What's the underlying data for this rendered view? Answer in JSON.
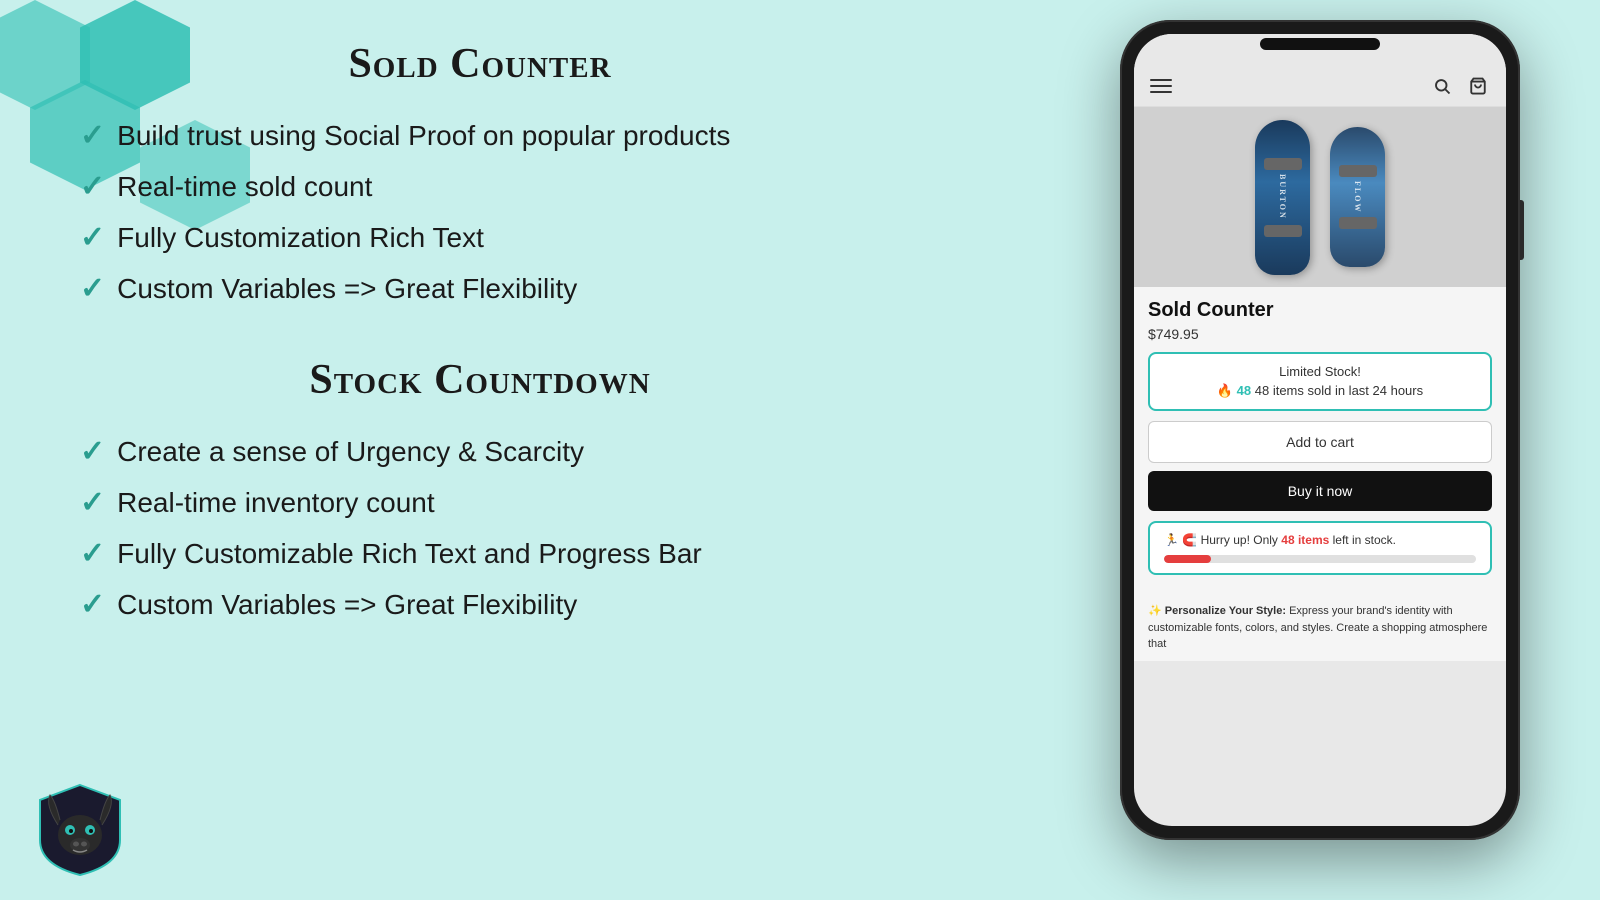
{
  "background_color": "#c8f0ec",
  "hex_color": "#2fbfb4",
  "sold_counter": {
    "title": "Sold Counter",
    "features": [
      "Build trust using Social Proof on popular products",
      "Real-time sold count",
      "Fully Customization Rich Text",
      "Custom Variables => Great Flexibility"
    ]
  },
  "stock_countdown": {
    "title": "Stock Countdown",
    "features": [
      "Create a sense of Urgency & Scarcity",
      "Real-time inventory count",
      "Fully Customizable Rich Text and Progress Bar",
      "Custom Variables => Great Flexibility"
    ]
  },
  "phone": {
    "product_name": "Sold Counter",
    "product_price": "$749.95",
    "sold_counter_box": {
      "title_text": "Limited Stock!",
      "detail_text": " 48 items sold in last 24 hours",
      "count": "48"
    },
    "add_to_cart_label": "Add to cart",
    "buy_now_label": "Buy it now",
    "stock_box": {
      "text_before": "Hurry up! Only ",
      "count": "48 items",
      "text_after": " left in stock."
    },
    "bottom_text_bold": "Personalize Your Style:",
    "bottom_text": " Express your brand's identity with customizable fonts, colors, and styles. Create a shopping atmosphere that"
  }
}
